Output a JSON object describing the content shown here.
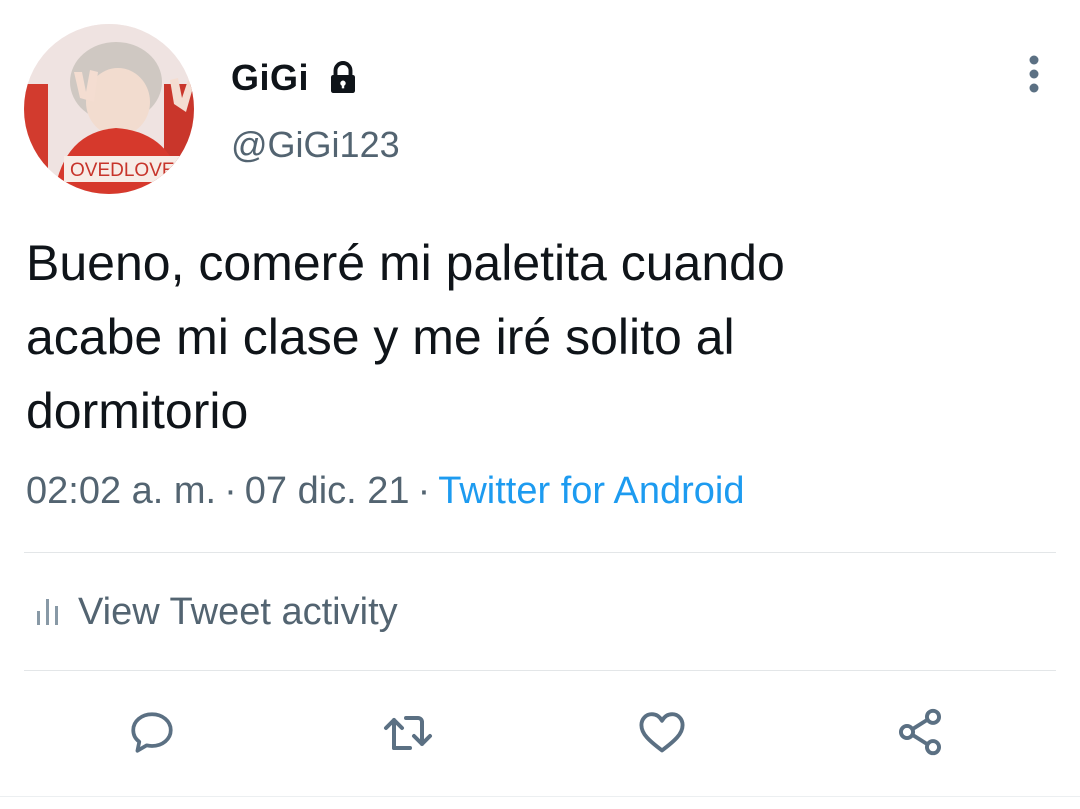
{
  "user": {
    "display_name": "GiGi",
    "handle": "@GiGi123",
    "protected_icon": "lock-icon",
    "avatar_text": "OVEDLOVE"
  },
  "header": {
    "more_icon": "more-vertical-icon"
  },
  "tweet": {
    "text": "Bueno, comeré mi paletita cuando\nacabe mi clase y me iré solito al\ndormitorio",
    "time": "02:02 a. m.",
    "separator": "·",
    "date": "07 dic. 21",
    "source": "Twitter for Android"
  },
  "activity": {
    "icon": "analytics-bars-icon",
    "label": "View Tweet activity"
  },
  "actions": [
    {
      "name": "reply",
      "icon": "reply-icon"
    },
    {
      "name": "retweet",
      "icon": "retweet-icon"
    },
    {
      "name": "like",
      "icon": "heart-icon"
    },
    {
      "name": "share",
      "icon": "share-icon"
    }
  ],
  "colors": {
    "link": "#1d9bf0",
    "secondary_text": "#536471",
    "primary_text": "#0f1419",
    "icon": "#5b7083"
  }
}
